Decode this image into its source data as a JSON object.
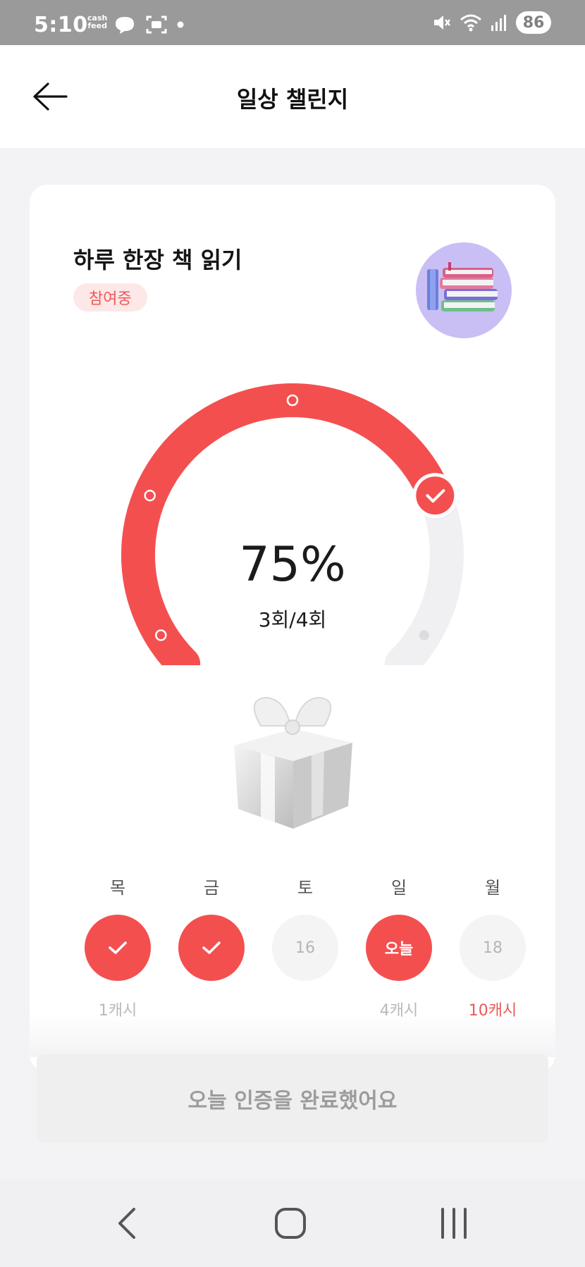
{
  "status_bar": {
    "time": "5:10",
    "app_badge_line1": "cash",
    "app_badge_line2": "feed",
    "battery": "86"
  },
  "header": {
    "title": "일상 챌린지"
  },
  "challenge": {
    "title": "하루 한장 책 읽기",
    "status": "참여중",
    "progress_percent_label": "75%",
    "progress_fraction": 0.75,
    "count_label": "3회/4회"
  },
  "days": [
    {
      "label": "목",
      "state": "done",
      "value": "",
      "reward": "1캐시"
    },
    {
      "label": "금",
      "state": "done",
      "value": "",
      "reward": ""
    },
    {
      "label": "토",
      "state": "future",
      "value": "16",
      "reward": ""
    },
    {
      "label": "일",
      "state": "today",
      "value": "오늘",
      "reward": "4캐시"
    },
    {
      "label": "월",
      "state": "future",
      "value": "18",
      "reward": "10캐시"
    }
  ],
  "complete_button": {
    "label": "오늘 인증을 완료했어요"
  },
  "colors": {
    "accent": "#f44f4f",
    "pill_bg": "#fde7e7",
    "avatar_bg": "#c9bff5"
  },
  "icons": [
    "back-arrow-icon",
    "check-icon",
    "books-icon",
    "gift-icon",
    "nav-back-icon",
    "nav-home-icon",
    "nav-recents-icon"
  ]
}
